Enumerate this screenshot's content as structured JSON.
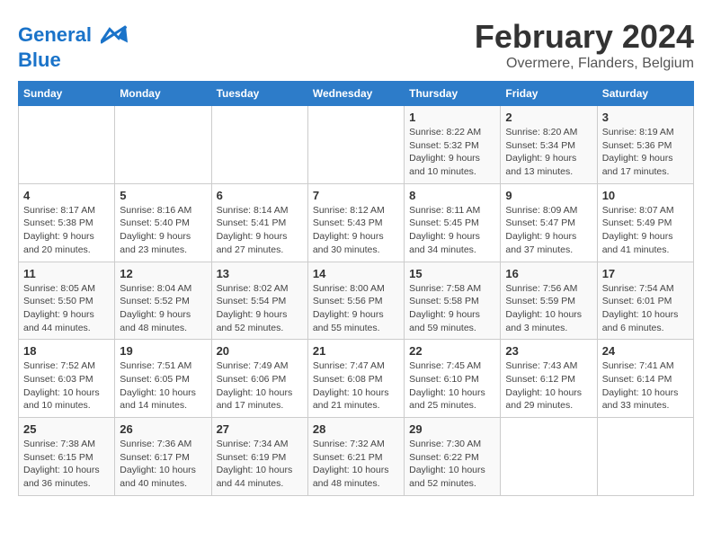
{
  "header": {
    "logo_line1": "General",
    "logo_line2": "Blue",
    "main_title": "February 2024",
    "subtitle": "Overmere, Flanders, Belgium"
  },
  "calendar": {
    "weekdays": [
      "Sunday",
      "Monday",
      "Tuesday",
      "Wednesday",
      "Thursday",
      "Friday",
      "Saturday"
    ],
    "weeks": [
      [
        {
          "day": "",
          "info": ""
        },
        {
          "day": "",
          "info": ""
        },
        {
          "day": "",
          "info": ""
        },
        {
          "day": "",
          "info": ""
        },
        {
          "day": "1",
          "info": "Sunrise: 8:22 AM\nSunset: 5:32 PM\nDaylight: 9 hours\nand 10 minutes."
        },
        {
          "day": "2",
          "info": "Sunrise: 8:20 AM\nSunset: 5:34 PM\nDaylight: 9 hours\nand 13 minutes."
        },
        {
          "day": "3",
          "info": "Sunrise: 8:19 AM\nSunset: 5:36 PM\nDaylight: 9 hours\nand 17 minutes."
        }
      ],
      [
        {
          "day": "4",
          "info": "Sunrise: 8:17 AM\nSunset: 5:38 PM\nDaylight: 9 hours\nand 20 minutes."
        },
        {
          "day": "5",
          "info": "Sunrise: 8:16 AM\nSunset: 5:40 PM\nDaylight: 9 hours\nand 23 minutes."
        },
        {
          "day": "6",
          "info": "Sunrise: 8:14 AM\nSunset: 5:41 PM\nDaylight: 9 hours\nand 27 minutes."
        },
        {
          "day": "7",
          "info": "Sunrise: 8:12 AM\nSunset: 5:43 PM\nDaylight: 9 hours\nand 30 minutes."
        },
        {
          "day": "8",
          "info": "Sunrise: 8:11 AM\nSunset: 5:45 PM\nDaylight: 9 hours\nand 34 minutes."
        },
        {
          "day": "9",
          "info": "Sunrise: 8:09 AM\nSunset: 5:47 PM\nDaylight: 9 hours\nand 37 minutes."
        },
        {
          "day": "10",
          "info": "Sunrise: 8:07 AM\nSunset: 5:49 PM\nDaylight: 9 hours\nand 41 minutes."
        }
      ],
      [
        {
          "day": "11",
          "info": "Sunrise: 8:05 AM\nSunset: 5:50 PM\nDaylight: 9 hours\nand 44 minutes."
        },
        {
          "day": "12",
          "info": "Sunrise: 8:04 AM\nSunset: 5:52 PM\nDaylight: 9 hours\nand 48 minutes."
        },
        {
          "day": "13",
          "info": "Sunrise: 8:02 AM\nSunset: 5:54 PM\nDaylight: 9 hours\nand 52 minutes."
        },
        {
          "day": "14",
          "info": "Sunrise: 8:00 AM\nSunset: 5:56 PM\nDaylight: 9 hours\nand 55 minutes."
        },
        {
          "day": "15",
          "info": "Sunrise: 7:58 AM\nSunset: 5:58 PM\nDaylight: 9 hours\nand 59 minutes."
        },
        {
          "day": "16",
          "info": "Sunrise: 7:56 AM\nSunset: 5:59 PM\nDaylight: 10 hours\nand 3 minutes."
        },
        {
          "day": "17",
          "info": "Sunrise: 7:54 AM\nSunset: 6:01 PM\nDaylight: 10 hours\nand 6 minutes."
        }
      ],
      [
        {
          "day": "18",
          "info": "Sunrise: 7:52 AM\nSunset: 6:03 PM\nDaylight: 10 hours\nand 10 minutes."
        },
        {
          "day": "19",
          "info": "Sunrise: 7:51 AM\nSunset: 6:05 PM\nDaylight: 10 hours\nand 14 minutes."
        },
        {
          "day": "20",
          "info": "Sunrise: 7:49 AM\nSunset: 6:06 PM\nDaylight: 10 hours\nand 17 minutes."
        },
        {
          "day": "21",
          "info": "Sunrise: 7:47 AM\nSunset: 6:08 PM\nDaylight: 10 hours\nand 21 minutes."
        },
        {
          "day": "22",
          "info": "Sunrise: 7:45 AM\nSunset: 6:10 PM\nDaylight: 10 hours\nand 25 minutes."
        },
        {
          "day": "23",
          "info": "Sunrise: 7:43 AM\nSunset: 6:12 PM\nDaylight: 10 hours\nand 29 minutes."
        },
        {
          "day": "24",
          "info": "Sunrise: 7:41 AM\nSunset: 6:14 PM\nDaylight: 10 hours\nand 33 minutes."
        }
      ],
      [
        {
          "day": "25",
          "info": "Sunrise: 7:38 AM\nSunset: 6:15 PM\nDaylight: 10 hours\nand 36 minutes."
        },
        {
          "day": "26",
          "info": "Sunrise: 7:36 AM\nSunset: 6:17 PM\nDaylight: 10 hours\nand 40 minutes."
        },
        {
          "day": "27",
          "info": "Sunrise: 7:34 AM\nSunset: 6:19 PM\nDaylight: 10 hours\nand 44 minutes."
        },
        {
          "day": "28",
          "info": "Sunrise: 7:32 AM\nSunset: 6:21 PM\nDaylight: 10 hours\nand 48 minutes."
        },
        {
          "day": "29",
          "info": "Sunrise: 7:30 AM\nSunset: 6:22 PM\nDaylight: 10 hours\nand 52 minutes."
        },
        {
          "day": "",
          "info": ""
        },
        {
          "day": "",
          "info": ""
        }
      ]
    ]
  }
}
